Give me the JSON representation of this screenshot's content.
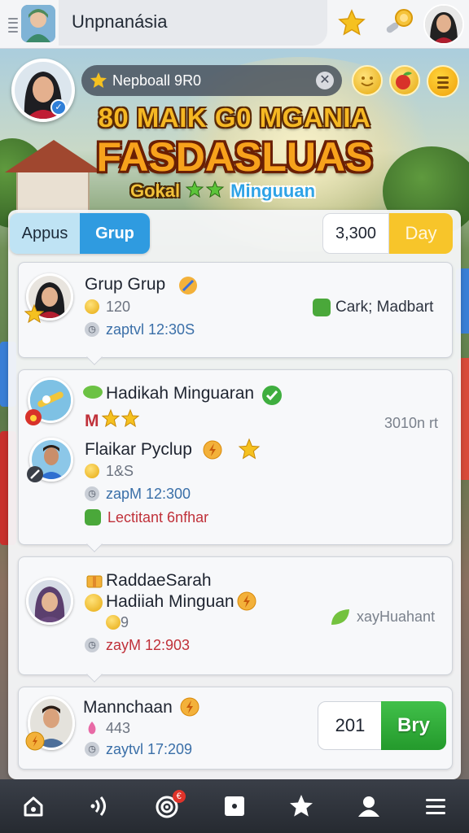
{
  "topbar": {
    "title": "Unpnanásia"
  },
  "header": {
    "search_text": "Nepboall 9R0",
    "clear_glyph": "✕",
    "banner_line1": "80 MAIK G0 MGANIA",
    "banner_line2": "FASDASLUAS",
    "banner_left": "Gokal",
    "banner_right": "Minguuan"
  },
  "tabs": {
    "apps_label": "Appus",
    "grup_label": "Grup",
    "count": "3,300",
    "day_label": "Day"
  },
  "cards": [
    {
      "name": "Grup Grup",
      "coins": "120",
      "time": "zaptvl 12:30S",
      "right": "Cark; Madbart"
    },
    {
      "title": "Hadikah Minguaran",
      "rank": "M",
      "right": "3010n rt",
      "name": "Flaikar Pyclup",
      "coins": "1&S",
      "time": "zapM 12:300",
      "note": "Lectitant 6nfhar"
    },
    {
      "title": "RaddaeSarah",
      "name": "Hadiiah Minguan",
      "coins": "9",
      "time": "zayM 12:903",
      "right": "xayHuahant"
    },
    {
      "name": "Mannchaan",
      "coins": "443",
      "time": "zaytvl 17:209",
      "qty": "201",
      "buy_label": "Bry"
    }
  ],
  "nav": {
    "items": [
      "home-icon",
      "signal-icon",
      "target-icon",
      "square-icon",
      "star-icon",
      "profile-icon",
      "menu-icon"
    ],
    "target_badge": "€"
  },
  "colors": {
    "accent_blue": "#2f9be0",
    "accent_yellow": "#f7c52a",
    "buy_green": "#2fae37",
    "banner_orange": "#f7a21c"
  }
}
